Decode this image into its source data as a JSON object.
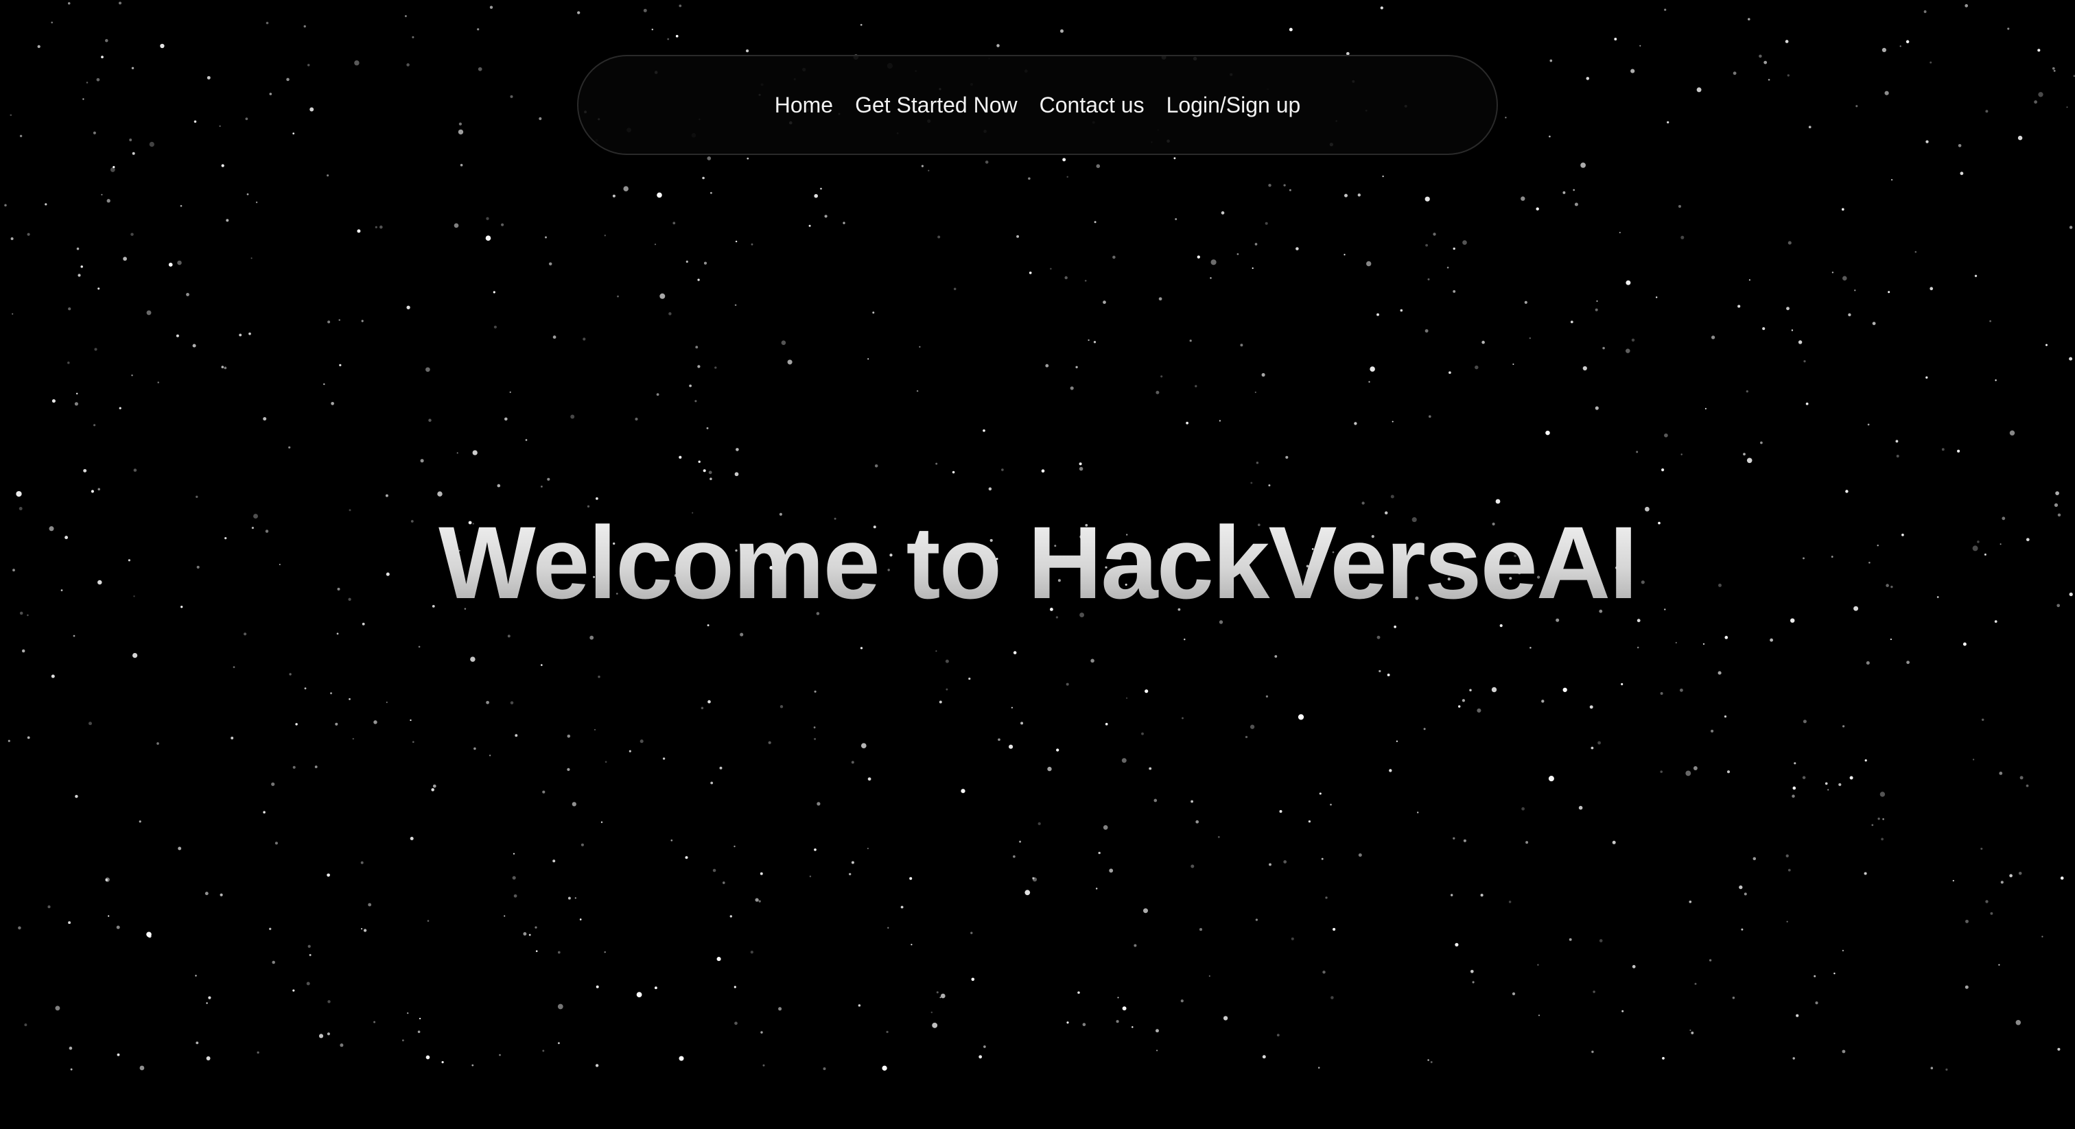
{
  "nav": {
    "items": [
      {
        "label": "Home"
      },
      {
        "label": "Get Started Now"
      },
      {
        "label": "Contact us"
      },
      {
        "label": "Login/Sign up"
      }
    ]
  },
  "hero": {
    "title": "Welcome to HackVerseAI"
  },
  "theme": {
    "background": "#000000",
    "star_color": "#ffffff",
    "nav_border": "#2a2a2a",
    "text": "#f2f2f2"
  }
}
